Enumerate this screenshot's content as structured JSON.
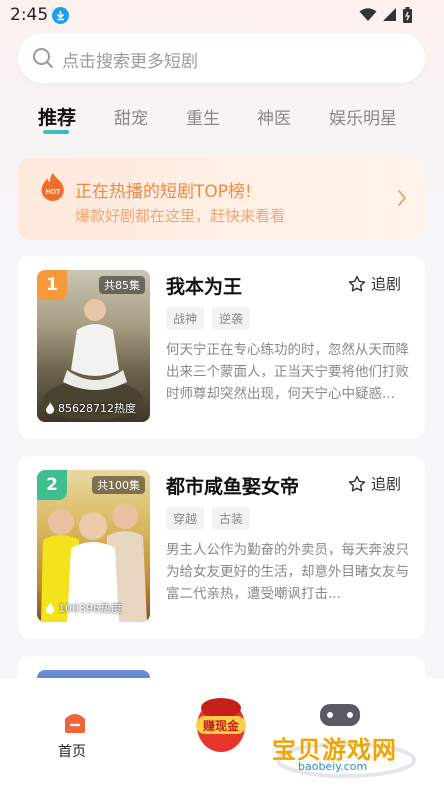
{
  "status_bar": {
    "time": "2:45"
  },
  "search": {
    "placeholder": "点击搜索更多短剧"
  },
  "tabs": [
    {
      "label": "推荐",
      "active": true
    },
    {
      "label": "甜宠",
      "active": false
    },
    {
      "label": "重生",
      "active": false
    },
    {
      "label": "神医",
      "active": false
    },
    {
      "label": "娱乐明星",
      "active": false
    }
  ],
  "hot_banner": {
    "badge": "HOT",
    "title": "正在热播的短剧TOP榜!",
    "subtitle": "爆款好剧都在这里，赶快来看看"
  },
  "dramas": [
    {
      "rank": "1",
      "rank_color": "#f59b3a",
      "episodes": "共85集",
      "heat": "85628712热度",
      "title": "我本为王",
      "follow_label": "追剧",
      "tags": [
        "战神",
        "逆袭"
      ],
      "description": "何天宁正在专心练功的时，忽然从天而降出来三个蒙面人，正当天宁要将他们打败时师尊却突然出现，何天宁心中疑惑..."
    },
    {
      "rank": "2",
      "rank_color": "#3fbf8f",
      "episodes": "共100集",
      "heat": "100396热度",
      "title": "都市咸鱼娶女帝",
      "follow_label": "追剧",
      "tags": [
        "穿越",
        "古装"
      ],
      "description": "男主人公作为勤奋的外卖员，每天奔波只为给女友更好的生活，却意外目睹女友与富二代亲热，遭受嘲讽打击..."
    }
  ],
  "bottom_nav": {
    "home_label": "首页",
    "cash_label": "赚现金",
    "watermark_text": "宝贝游戏网",
    "watermark_url": "baobeiy.com"
  },
  "colors": {
    "accent_green": "#3fbf8f",
    "hot_orange": "#f08a3c",
    "home_icon": "#f0663a"
  }
}
